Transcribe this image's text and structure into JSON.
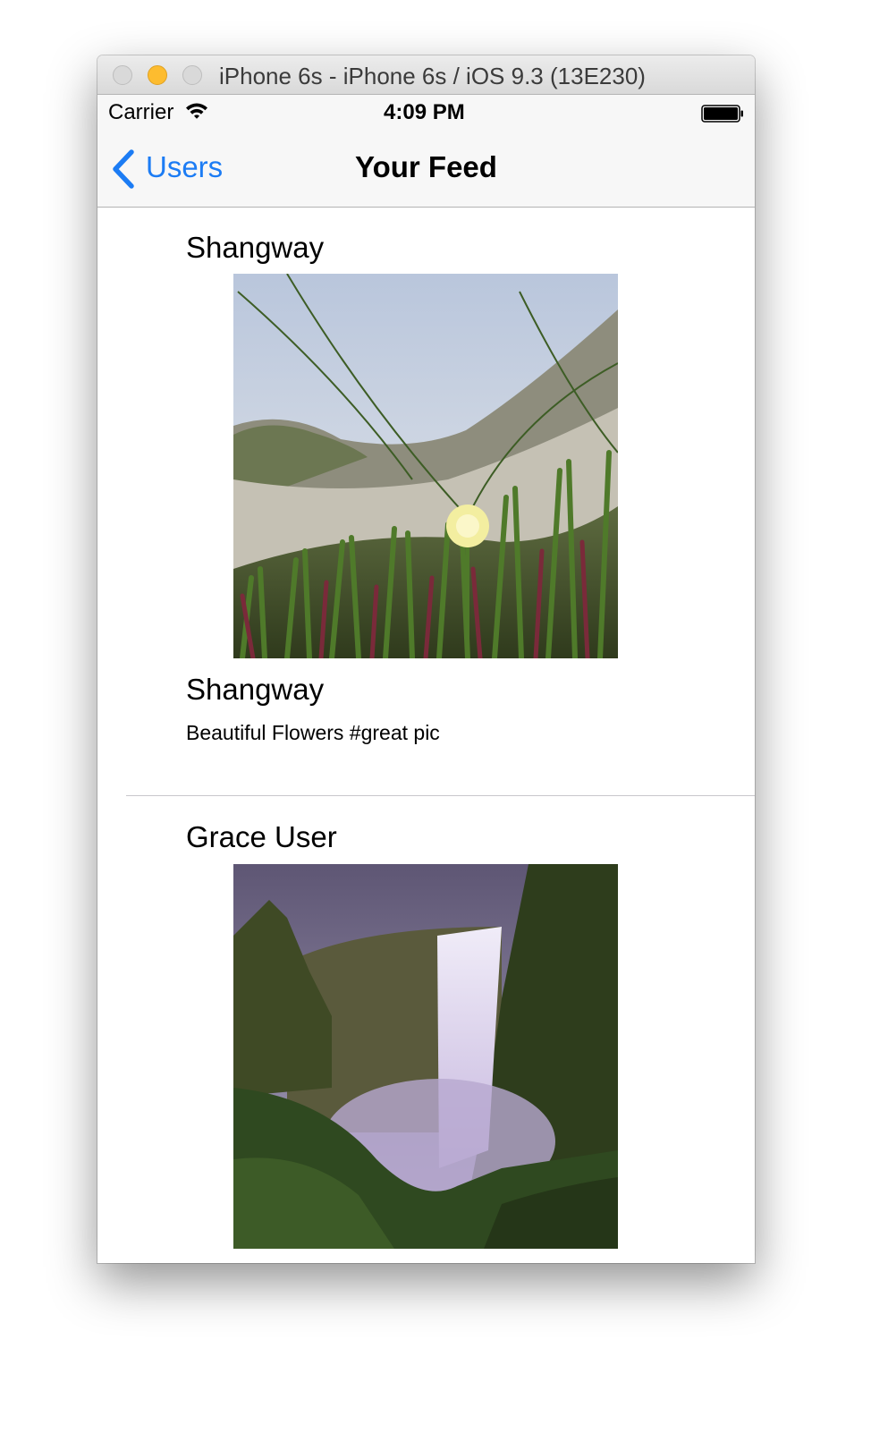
{
  "window": {
    "title": "iPhone 6s - iPhone 6s / iOS 9.3 (13E230)"
  },
  "status_bar": {
    "carrier": "Carrier",
    "time": "4:09 PM",
    "wifi_icon": "wifi-icon",
    "battery_icon": "battery-icon",
    "battery_level": 1.0
  },
  "nav": {
    "back_label": "Users",
    "back_icon": "chevron-left-icon",
    "title": "Your Feed",
    "accent_color": "#1c7cf4"
  },
  "posts": [
    {
      "username": "Shangway",
      "photo": "flower-photo",
      "caption_user": "Shangway",
      "caption": "Beautiful Flowers #great pic"
    },
    {
      "username": "Grace User",
      "photo": "waterfall-photo"
    }
  ]
}
